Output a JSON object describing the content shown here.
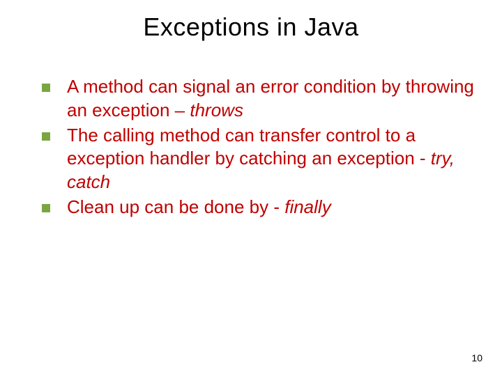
{
  "title": "Exceptions in Java",
  "bullets": [
    {
      "pre": "A method can signal an error condition by throwing an exception – ",
      "kw": "throws",
      "post": ""
    },
    {
      "pre": "The calling method can transfer control to a exception handler  by catching an exception -  ",
      "kw": "try, catch",
      "post": ""
    },
    {
      "pre": "Clean up can be done by -  ",
      "kw": "finally",
      "post": ""
    }
  ],
  "page_number": "10"
}
